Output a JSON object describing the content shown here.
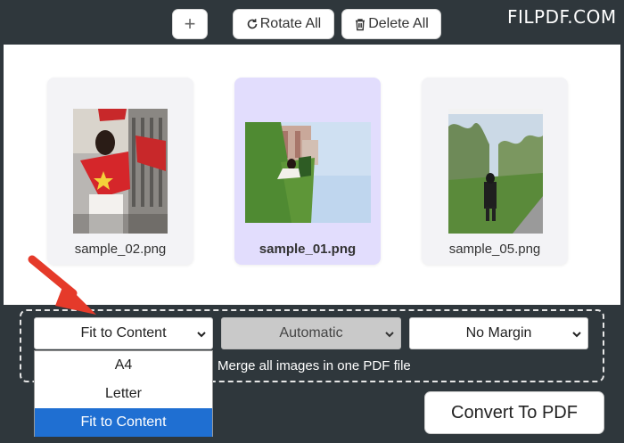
{
  "toolbar": {
    "add_label": "+",
    "rotate_label": "Rotate All",
    "delete_label": "Delete All"
  },
  "logo": "FILPDF.COM",
  "gallery": {
    "items": [
      {
        "name": "sample_02.png",
        "selected": false
      },
      {
        "name": "sample_01.png",
        "selected": true
      },
      {
        "name": "sample_05.png",
        "selected": false
      }
    ]
  },
  "options": {
    "page_size": {
      "selected": "Fit to Content",
      "options": [
        "A4",
        "Letter",
        "Fit to Content"
      ]
    },
    "orientation": {
      "selected": "Automatic"
    },
    "margin": {
      "selected": "No Margin"
    },
    "merge_label": "Merge all images in one PDF file"
  },
  "convert_label": "Convert To PDF",
  "colors": {
    "background": "#2f373c",
    "selected_card": "#e2ddfd",
    "dropdown_highlight": "#1f6fd2",
    "arrow": "#e53a2a"
  }
}
